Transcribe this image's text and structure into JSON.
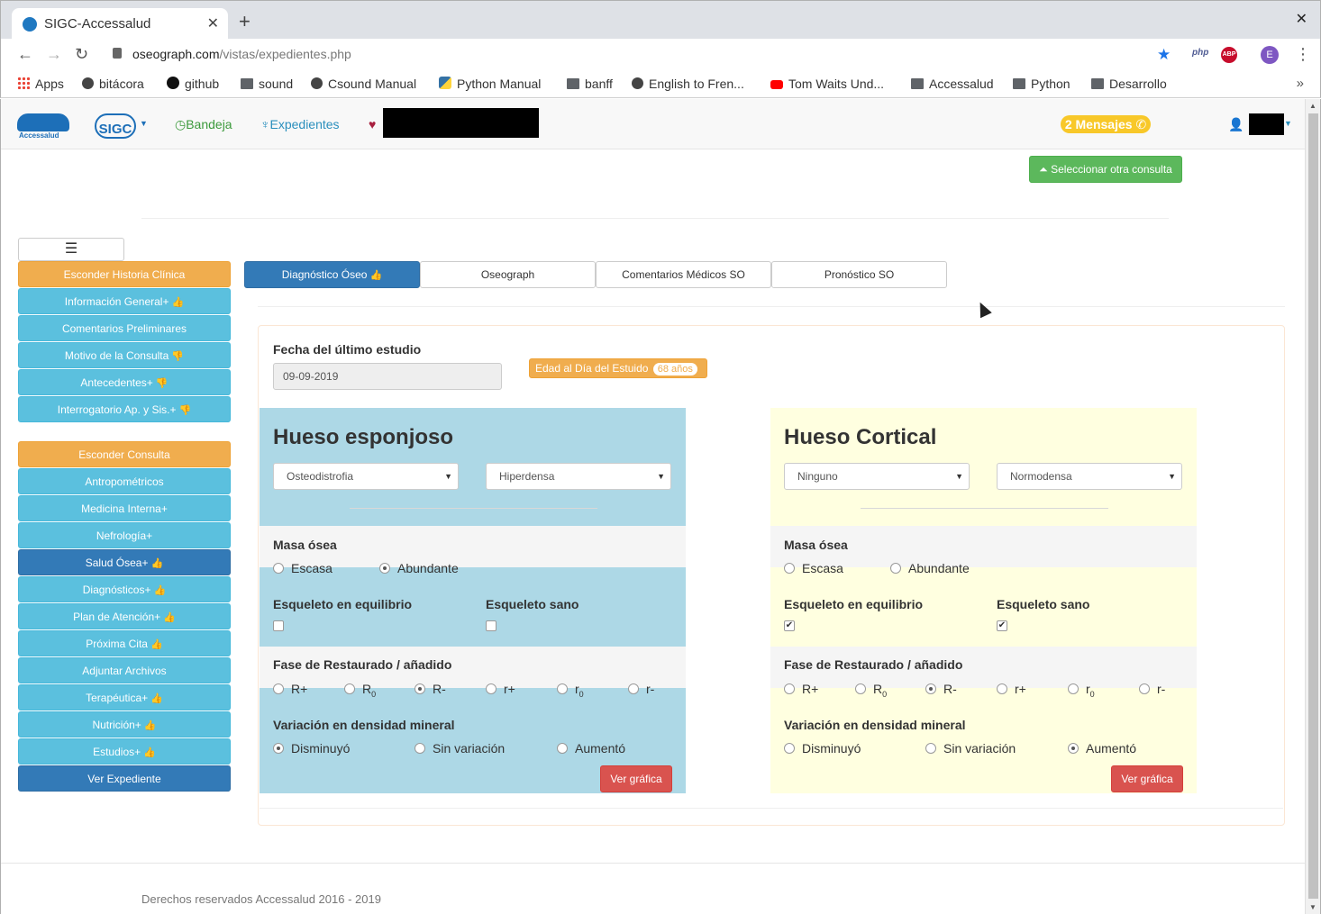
{
  "browser": {
    "tab_title": "SIGC-Accessalud",
    "tab_close": "✕",
    "new_tab": "+",
    "window_close": "✕",
    "url_domain": "oseograph.com",
    "url_path": "/vistas/expedientes.php",
    "ext_php": "php",
    "ext_abp": "ABP",
    "profile_initial": "E",
    "bookmarks": [
      {
        "label": "Apps",
        "icon": "apps-icon"
      },
      {
        "label": "bitácora",
        "icon": "globe-icon"
      },
      {
        "label": "github",
        "icon": "github-icon"
      },
      {
        "label": "sound",
        "icon": "folder-icon"
      },
      {
        "label": "Csound Manual",
        "icon": "globe-icon"
      },
      {
        "label": "Python Manual",
        "icon": "python-icon"
      },
      {
        "label": "banff",
        "icon": "folder-icon"
      },
      {
        "label": "English to Fren...",
        "icon": "globe-icon"
      },
      {
        "label": "Tom Waits Und...",
        "icon": "youtube-icon"
      },
      {
        "label": "Accessalud",
        "icon": "folder-icon"
      },
      {
        "label": "Python",
        "icon": "folder-icon"
      },
      {
        "label": "Desarrollo",
        "icon": "folder-icon"
      }
    ],
    "bookmarks_more": "»"
  },
  "navbar": {
    "logo_text": "Accessalud",
    "sigc_text": "SIGC",
    "bandeja": "Bandeja",
    "expedientes": "Expedientes",
    "mensajes": "2 Mensajes"
  },
  "actions": {
    "select_consulta": "Seleccionar otra consulta"
  },
  "sidebar": {
    "historia": [
      {
        "label": "Esconder Historia Clínica",
        "style": "orange",
        "mark": ""
      },
      {
        "label": "Información General+",
        "style": "cyan",
        "mark": "up"
      },
      {
        "label": "Comentarios Preliminares",
        "style": "cyan",
        "mark": ""
      },
      {
        "label": "Motivo de la Consulta",
        "style": "cyan",
        "mark": "down"
      },
      {
        "label": "Antecedentes+",
        "style": "cyan",
        "mark": "down"
      },
      {
        "label": "Interrogatorio Ap. y Sis.+",
        "style": "cyan",
        "mark": "down"
      }
    ],
    "consulta": [
      {
        "label": "Esconder Consulta",
        "style": "orange",
        "mark": ""
      },
      {
        "label": "Antropométricos",
        "style": "cyan",
        "mark": ""
      },
      {
        "label": "Medicina Interna+",
        "style": "cyan",
        "mark": ""
      },
      {
        "label": "Nefrología+",
        "style": "cyan",
        "mark": ""
      },
      {
        "label": "Salud Ósea+",
        "style": "dark",
        "mark": "up"
      },
      {
        "label": "Diagnósticos+",
        "style": "cyan",
        "mark": "up"
      },
      {
        "label": "Plan de Atención+",
        "style": "cyan",
        "mark": "up"
      },
      {
        "label": "Próxima Cita",
        "style": "cyan",
        "mark": "up"
      },
      {
        "label": "Adjuntar Archivos",
        "style": "cyan",
        "mark": ""
      },
      {
        "label": "Terapéutica+",
        "style": "cyan",
        "mark": "up"
      },
      {
        "label": "Nutrición+",
        "style": "cyan",
        "mark": "up"
      },
      {
        "label": "Estudios+",
        "style": "cyan",
        "mark": "up"
      },
      {
        "label": "Ver Expediente",
        "style": "dark",
        "mark": ""
      }
    ]
  },
  "tabs": [
    {
      "label": "Diagnóstico Óseo",
      "active": true
    },
    {
      "label": "Oseograph",
      "active": false
    },
    {
      "label": "Comentarios Médicos SO",
      "active": false
    },
    {
      "label": "Pronóstico SO",
      "active": false
    }
  ],
  "estudio": {
    "fecha_label": "Fecha del último estudio",
    "fecha_value": "09-09-2019",
    "edad_label": "Edad al Día del Estuido",
    "edad_value": "68 años"
  },
  "labels": {
    "masa": "Masa ósea",
    "escasa": "Escasa",
    "abundante": "Abundante",
    "equilibrio": "Esqueleto en equilibrio",
    "sano": "Esqueleto sano",
    "fase": "Fase de Restaurado / añadido",
    "variacion": "Variación en densidad mineral",
    "disminuyo": "Disminuyó",
    "sin_variacion": "Sin variación",
    "aumento": "Aumentó",
    "ver_grafica": "Ver gráfica"
  },
  "fases": [
    "R+",
    "R",
    "R-",
    "r+",
    "r",
    "r-"
  ],
  "fase_subs": [
    "",
    "0",
    "",
    "",
    "0",
    ""
  ],
  "esponjoso": {
    "title": "Hueso esponjoso",
    "select1": "Osteodistrofia",
    "select2": "Hiperdensa",
    "masa": "Abundante",
    "equilibrio": false,
    "sano": false,
    "fase": "R-",
    "variacion": "Disminuyó"
  },
  "cortical": {
    "title": "Hueso Cortical",
    "select1": "Ninguno",
    "select2": "Normodensa",
    "masa": "",
    "equilibrio": true,
    "sano": true,
    "fase": "R-",
    "variacion": "Aumentó"
  },
  "colors": {
    "esponjoso_bg": "#add8e6",
    "cortical_bg": "#ffffe0",
    "row_gray": "#f5f5f5"
  },
  "footer": "Derechos reservados Accessalud 2016 - 2019"
}
